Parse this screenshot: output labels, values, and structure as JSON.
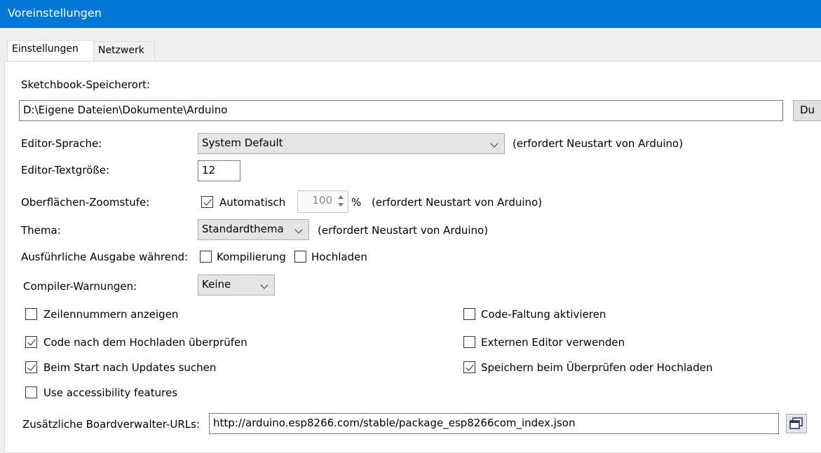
{
  "window": {
    "title": "Voreinstellungen"
  },
  "tabs": [
    {
      "label": "Einstellungen",
      "active": true
    },
    {
      "label": "Netzwerk",
      "active": false
    }
  ],
  "sketchbook": {
    "label": "Sketchbook-Speicherort:",
    "path": "D:\\Eigene Dateien\\Dokumente\\Arduino",
    "browse_label": "Du"
  },
  "editor_language": {
    "label": "Editor-Sprache:",
    "value": "System Default",
    "note": "(erfordert Neustart von Arduino)"
  },
  "editor_text_size": {
    "label": "Editor-Textgröße:",
    "value": "12"
  },
  "zoom": {
    "label": "Oberflächen-Zoomstufe:",
    "auto_label": "Automatisch",
    "auto_checked": true,
    "value": "100",
    "unit": "%",
    "note": "(erfordert Neustart von Arduino)"
  },
  "theme": {
    "label": "Thema:",
    "value": "Standardthema",
    "note": "(erfordert Neustart von Arduino)"
  },
  "verbose": {
    "label": "Ausführliche Ausgabe während:",
    "compile_label": "Kompilierung",
    "compile_checked": false,
    "upload_label": "Hochladen",
    "upload_checked": false
  },
  "compiler_warnings": {
    "label": "Compiler-Warnungen:",
    "value": "Keine"
  },
  "options": {
    "line_numbers": {
      "label": "Zeilennummern anzeigen",
      "checked": false
    },
    "verify_after_upload": {
      "label": "Code nach dem Hochladen überprüfen",
      "checked": true
    },
    "check_updates": {
      "label": "Beim Start nach Updates suchen",
      "checked": true
    },
    "accessibility": {
      "label": "Use accessibility features",
      "checked": false
    },
    "code_folding": {
      "label": "Code-Faltung aktivieren",
      "checked": false
    },
    "external_editor": {
      "label": "Externen Editor verwenden",
      "checked": false
    },
    "save_on_verify": {
      "label": "Speichern beim Überprüfen oder Hochladen",
      "checked": true
    }
  },
  "board_urls": {
    "label": "Zusätzliche Boardverwalter-URLs:",
    "value": "http://arduino.esp8266.com/stable/package_esp8266com_index.json"
  }
}
